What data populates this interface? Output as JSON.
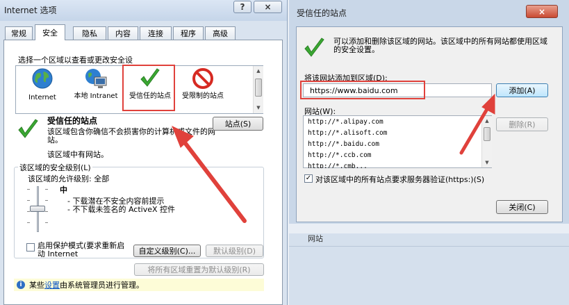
{
  "left_window": {
    "title": "Internet 选项",
    "help_button": "?",
    "close_button": "×",
    "tabs": [
      "常规",
      "安全",
      "隐私",
      "内容",
      "连接",
      "程序",
      "高级"
    ],
    "active_tab": "安全",
    "instruction": "选择一个区域以查看或更改安全设",
    "zones": [
      {
        "name": "Internet",
        "icon": "globe-icon"
      },
      {
        "name": "本地 Intranet",
        "icon": "intranet-icon"
      },
      {
        "name": "受信任的站点",
        "icon": "checkmark-icon"
      },
      {
        "name": "受限制的站点",
        "icon": "restricted-icon"
      }
    ],
    "selected_zone": {
      "title": "受信任的站点",
      "desc1": "该区域包含你确信不会损害你的计算机或文件的网站。",
      "desc2": "该区域中有网站。",
      "sites_button": "站点(S)"
    },
    "security_level": {
      "group_label": "该区域的安全级别(L)",
      "allowed_levels": "该区域的允许级别: 全部",
      "level": "中",
      "bullet1": "- 下载潜在不安全内容前提示",
      "bullet2": "- 不下载未签名的 ActiveX 控件",
      "slider_level": 0.5
    },
    "protected_mode": {
      "label": "启用保护模式(要求重新启动 Internet",
      "checked": false
    },
    "custom_level_button": "自定义级别(C)...",
    "default_level_button": "默认级别(D)",
    "reset_all_button": "将所有区域重置为默认级别(R)",
    "admin_notice": {
      "prefix": "某些",
      "link": "设置",
      "suffix": "由系统管理员进行管理。"
    }
  },
  "right_window": {
    "title": "受信任的站点",
    "close_button": "×",
    "info_text": "可以添加和删除该区域的网站。该区域中的所有网站都使用区域的安全设置。",
    "add_label": "将该网站添加到区域(D):",
    "add_value": "https://www.baidu.com",
    "add_button": "添加(A)",
    "sites_label": "网站(W):",
    "sites": [
      "http://*.alipay.com",
      "http://*.alisoft.com",
      "http://*.baidu.com",
      "http://*.ccb.com",
      "http://*.cmb..."
    ],
    "remove_button": "删除(R)",
    "https_check": {
      "label": "对该区域中的所有站点要求服务器验证(https:)(S)",
      "checked": true
    },
    "close_dialog_button": "关闭(C)",
    "below_label": "网站"
  },
  "colors": {
    "highlight_red": "#e0413b",
    "check_green": "#3aa832",
    "link_blue": "#0b55c4",
    "notice_bg": "#fdfcd7"
  }
}
